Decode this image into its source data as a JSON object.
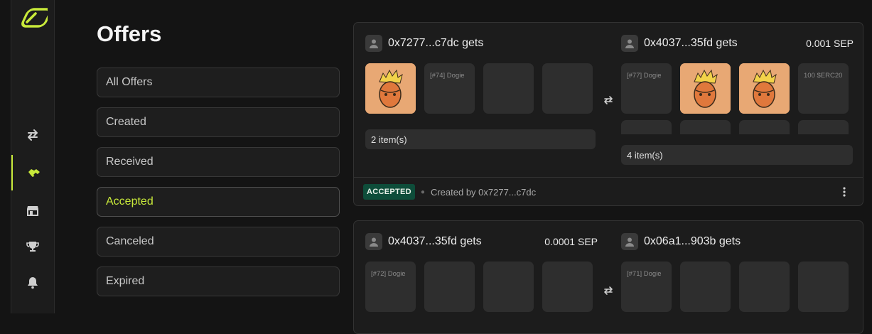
{
  "page": {
    "title": "Offers"
  },
  "sidebar": {
    "nav": [
      {
        "icon": "swap-arrows-icon"
      },
      {
        "icon": "handshake-icon",
        "active": true
      },
      {
        "icon": "store-icon"
      },
      {
        "icon": "trophy-icon"
      },
      {
        "icon": "bell-icon"
      }
    ]
  },
  "filters": [
    {
      "label": "All Offers",
      "active": false
    },
    {
      "label": "Created",
      "active": false
    },
    {
      "label": "Received",
      "active": false
    },
    {
      "label": "Accepted",
      "active": true
    },
    {
      "label": "Canceled",
      "active": false
    },
    {
      "label": "Expired",
      "active": false
    }
  ],
  "offers": [
    {
      "left": {
        "address": "0x7277...c7dc gets",
        "amount": "",
        "tiles": [
          {
            "type": "image"
          },
          {
            "type": "text",
            "text": "[#74] Dogie"
          },
          {
            "type": "empty"
          },
          {
            "type": "empty"
          }
        ],
        "items": "2 item(s)"
      },
      "right": {
        "address": "0x4037...35fd gets",
        "amount": "0.001 SEP",
        "tiles": [
          {
            "type": "text",
            "text": "[#77] Dogie"
          },
          {
            "type": "image"
          },
          {
            "type": "image"
          },
          {
            "type": "text",
            "text": "100 $ERC20"
          }
        ],
        "items": "4 item(s)"
      },
      "status": "ACCEPTED",
      "created_by": "Created by 0x7277...c7dc"
    },
    {
      "left": {
        "address": "0x4037...35fd gets",
        "amount": "0.0001 SEP",
        "tiles": [
          {
            "type": "text",
            "text": "[#72] Dogie"
          },
          {
            "type": "empty"
          },
          {
            "type": "empty"
          },
          {
            "type": "empty"
          }
        ]
      },
      "right": {
        "address": "0x06a1...903b gets",
        "amount": "",
        "tiles": [
          {
            "type": "text",
            "text": "[#71] Dogie"
          },
          {
            "type": "empty"
          },
          {
            "type": "empty"
          },
          {
            "type": "empty"
          }
        ]
      }
    }
  ],
  "colors": {
    "accent": "#c8e93a",
    "badge": "#0e4d3a",
    "background": "#141414"
  }
}
